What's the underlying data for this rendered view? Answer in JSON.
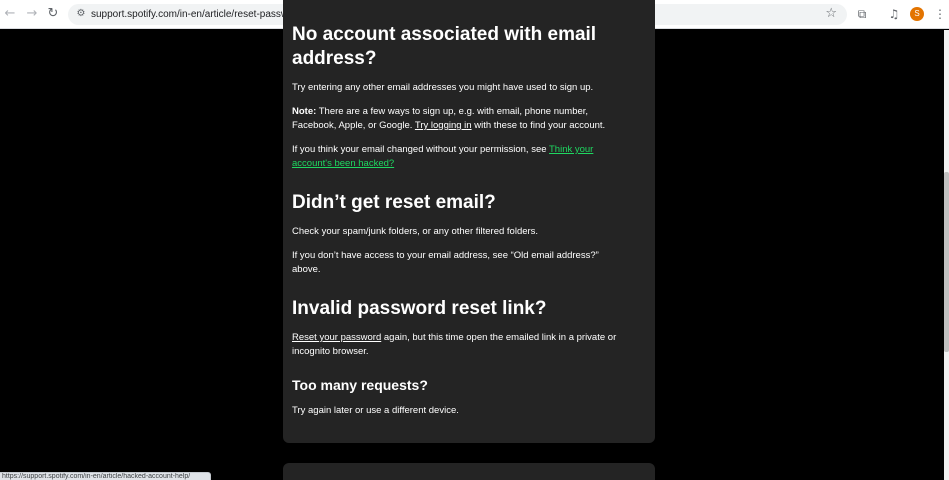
{
  "browser": {
    "url": "support.spotify.com/in-en/article/reset-password/",
    "profile_initial": "S",
    "icons": {
      "back": "arrow-left-icon",
      "forward": "arrow-right-icon",
      "reload": "reload-icon",
      "site_info": "tune-icon",
      "bookmark": "star-icon",
      "extensions": "puzzle-icon",
      "media": "media-control-icon",
      "menu": "kebab-menu-icon"
    },
    "glyphs": {
      "back": "←",
      "forward": "→",
      "reload": "↻",
      "site_info": "⚙",
      "bookmark": "☆",
      "extensions": "⧉",
      "media": "♫",
      "menu": "⋮"
    },
    "accent": "#e37400"
  },
  "article": {
    "link_color": "#1ed760",
    "sections": {
      "no_account": {
        "heading_line1": "No account associated with email",
        "heading_line2": "address?",
        "p1": "Try entering any other email addresses you might have used to sign up.",
        "note_label": "Note:",
        "note_text_1": " There are a few ways to sign up, e.g. with email, phone number,",
        "note_text_2": "Facebook, Apple, or Google. ",
        "note_link": "Try logging in",
        "note_text_3": " with these to find your account.",
        "changed_text": "If you think your email changed without your permission, see ",
        "hacked_link_1": "Think your",
        "hacked_link_2": "account's been hacked?"
      },
      "no_reset_email": {
        "heading": "Didn’t get reset email?",
        "p1": "Check your spam/junk folders, or any other filtered folders.",
        "p2_line1": "If you don’t have access to your email address, see “Old email address?”",
        "p2_line2": "above."
      },
      "invalid_link": {
        "heading": "Invalid password reset link?",
        "reset_link": "Reset your password",
        "p1_line1_rest": " again, but this time open the emailed link in a private or",
        "p1_line2": "incognito browser."
      },
      "too_many": {
        "heading": "Too many requests?",
        "p1": "Try again later or use a different device."
      }
    }
  },
  "status_bar": {
    "text": "https://support.spotify.com/in-en/article/hacked-account-help/"
  }
}
